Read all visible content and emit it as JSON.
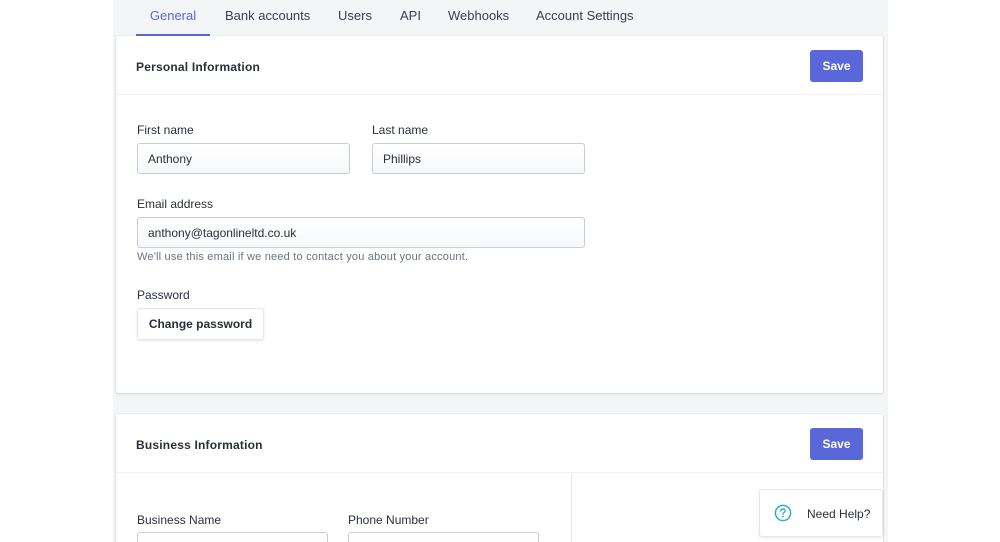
{
  "tabs": [
    {
      "label": "General",
      "active": true
    },
    {
      "label": "Bank accounts"
    },
    {
      "label": "Users"
    },
    {
      "label": "API"
    },
    {
      "label": "Webhooks"
    },
    {
      "label": "Account Settings"
    }
  ],
  "personal": {
    "title": "Personal Information",
    "save_label": "Save",
    "first_name": {
      "label": "First name",
      "value": "Anthony"
    },
    "last_name": {
      "label": "Last name",
      "value": "Phillips"
    },
    "email": {
      "label": "Email address",
      "value": "anthony@tagonlineltd.co.uk",
      "hint": "We'll use this email if we need to contact you about your account."
    },
    "password": {
      "label": "Password",
      "button_label": "Change password"
    }
  },
  "business": {
    "title": "Business Information",
    "save_label": "Save",
    "business_name": {
      "label": "Business Name",
      "value": ""
    },
    "phone_number": {
      "label": "Phone Number",
      "value": ""
    }
  },
  "help": {
    "label": "Need Help?"
  },
  "colors": {
    "accent": "#5a67d8",
    "background": "#f4f5f7",
    "help_icon": "#2bb5b5"
  },
  "icons": {
    "help": "question-circle-icon"
  }
}
